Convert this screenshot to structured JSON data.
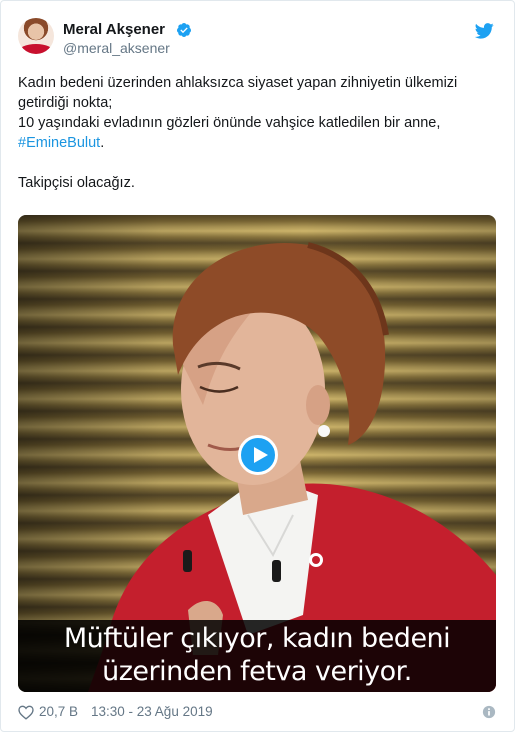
{
  "user": {
    "name": "Meral Akşener",
    "handle": "@meral_aksener",
    "verified": true
  },
  "tweet": {
    "line1": "Kadın bedeni üzerinden ahlaksızca siyaset yapan zihniyetin ülkemizi getirdiği nokta;",
    "line2": "10 yaşındaki evladının gözleri önünde vahşice katledilen bir anne,",
    "hashtag": "#EmineBulut",
    "hashtag_suffix": ".",
    "line3": "Takipçisi olacağız."
  },
  "video": {
    "subtitle_line1": "Müftüler çıkıyor, kadın bedeni",
    "subtitle_line2": "üzerinden fetva veriyor."
  },
  "footer": {
    "likes": "20,7 B",
    "timestamp": "13:30 - 23 Ağu 2019"
  },
  "colors": {
    "accent": "#1da1f2",
    "hashtag": "#1b95e0",
    "muted": "#657786",
    "jacket": "#c8102e"
  },
  "icons": [
    "verified-badge-icon",
    "twitter-bird-icon",
    "play-icon",
    "heart-icon",
    "info-icon"
  ]
}
